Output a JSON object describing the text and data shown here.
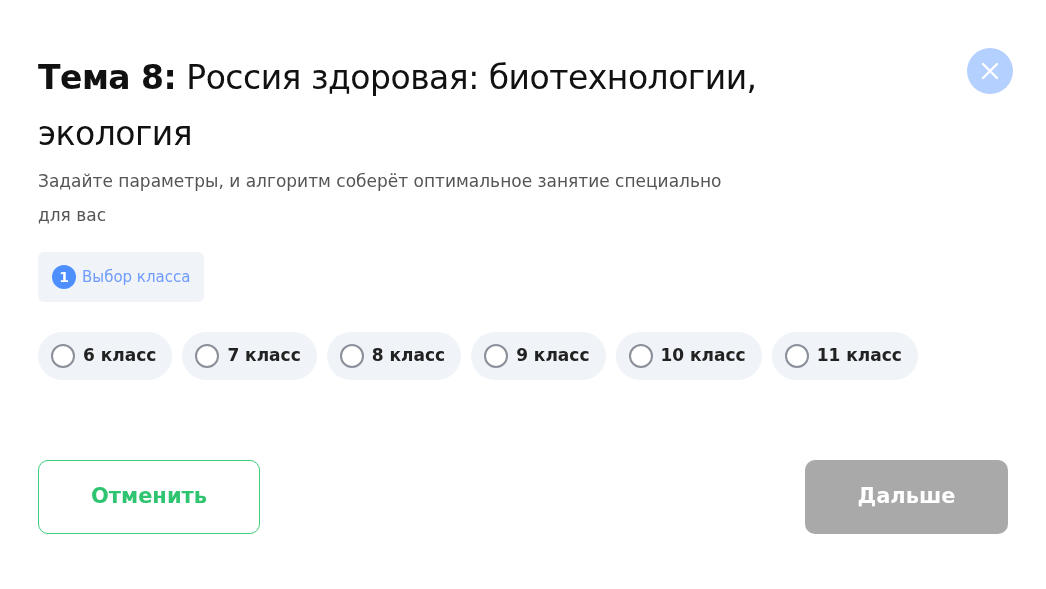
{
  "dialog": {
    "title": "**Тема 8:** Россия здоровая: биотехнологии, экология",
    "subtitle": "Задайте параметры, и алгоритм соберёт оптимальное занятие специально для вас"
  },
  "step": {
    "number": "1",
    "label": "Выбор класса"
  },
  "options": [
    {
      "label": "6 класс",
      "selected": false
    },
    {
      "label": "7 класс",
      "selected": false
    },
    {
      "label": "8 класс",
      "selected": false
    },
    {
      "label": "9 класс",
      "selected": false
    },
    {
      "label": "10 класс",
      "selected": false
    },
    {
      "label": "11 класс",
      "selected": false
    }
  ],
  "buttons": {
    "cancel": {
      "label": "Отменить"
    },
    "next": {
      "label": "Дальше",
      "disabled": true
    }
  }
}
